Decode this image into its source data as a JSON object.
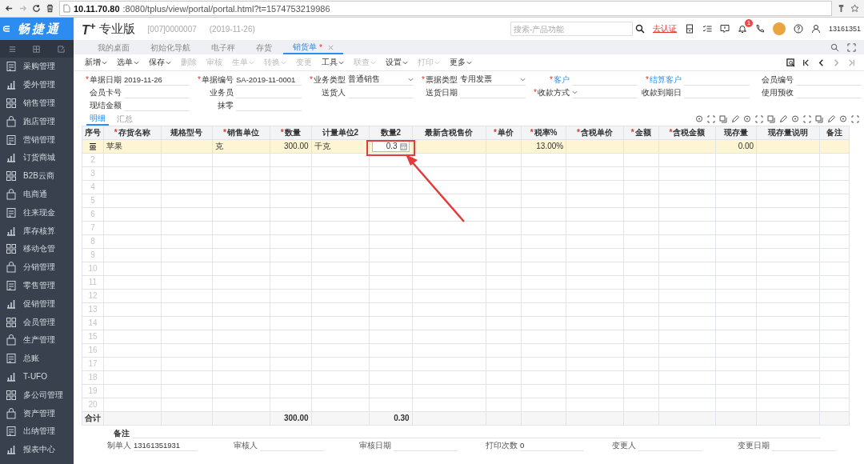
{
  "browser": {
    "url_host": "10.11.70.80",
    "url_rest": ":8080/tplus/view/portal/portal.html?t=1574753219986"
  },
  "sidebar": {
    "logo": "畅捷通",
    "items": [
      "采购管理",
      "委外管理",
      "销售管理",
      "跑店管理",
      "营销管理",
      "订货商城",
      "B2B云商",
      "电商通",
      "往来现金",
      "库存核算",
      "移动仓管",
      "分销管理",
      "零售管理",
      "促销管理",
      "会员管理",
      "生产管理",
      "总账",
      "T-UFO",
      "多公司管理",
      "资产管理",
      "出纳管理",
      "报表中心"
    ]
  },
  "header": {
    "logo": "T$^{+}$",
    "product": "专业版",
    "account": "[007]0000007",
    "date": "(2019-11-26)",
    "search": {
      "placeholder": "搜索-产品功能"
    },
    "verify_link": "去认证",
    "notification_count": "1",
    "user": "13161351"
  },
  "tabs": [
    {
      "label": "我的桌面",
      "selected": false,
      "closable": false
    },
    {
      "label": "初始化导航",
      "selected": false,
      "closable": false
    },
    {
      "label": "电子秤",
      "selected": false,
      "closable": false
    },
    {
      "label": "存货",
      "selected": false,
      "closable": false
    },
    {
      "label": "销货单",
      "selected": true,
      "closable": true,
      "modified_mark": "*"
    }
  ],
  "toolbar": [
    {
      "label": "新增",
      "dropdown": true,
      "disabled": false
    },
    {
      "label": "选单",
      "dropdown": true,
      "disabled": false
    },
    {
      "label": "保存",
      "dropdown": true,
      "disabled": false
    },
    {
      "label": "删除",
      "dropdown": false,
      "disabled": true
    },
    {
      "label": "审核",
      "dropdown": false,
      "disabled": true
    },
    {
      "label": "生单",
      "dropdown": true,
      "disabled": true
    },
    {
      "label": "转换",
      "dropdown": true,
      "disabled": true
    },
    {
      "label": "变更",
      "dropdown": false,
      "disabled": true
    },
    {
      "label": "工具",
      "dropdown": true,
      "disabled": false
    },
    {
      "label": "联查",
      "dropdown": true,
      "disabled": true
    },
    {
      "label": "设置",
      "dropdown": true,
      "disabled": false
    },
    {
      "label": "打印",
      "dropdown": true,
      "disabled": true
    },
    {
      "label": "更多",
      "dropdown": true,
      "disabled": false
    }
  ],
  "form": {
    "rows": [
      [
        {
          "label": "单据日期",
          "required_mark": "*",
          "kind": "text",
          "value": "2019-11-26"
        },
        {
          "label": "单据编号",
          "required_mark": "*",
          "kind": "text",
          "value": "SA-2019-11-0001"
        },
        {
          "label": "业务类型",
          "required_mark": "*",
          "kind": "select",
          "value": "普通销售"
        },
        {
          "label": "票据类型",
          "required_mark": "*",
          "kind": "select",
          "value": "专用发票"
        },
        {
          "label": "客户",
          "required_mark": "*",
          "kind": "lookup"
        },
        {
          "label": "结算客户",
          "required_mark": "*",
          "kind": "lookup"
        },
        {
          "label": "会员编号",
          "kind": "text"
        }
      ],
      [
        {
          "label": "会员卡号",
          "kind": "text"
        },
        {
          "label": "业务员",
          "kind": "text"
        },
        {
          "label": "送货人",
          "kind": "text"
        },
        {
          "label": "送货日期",
          "kind": "text"
        },
        {
          "label": "收款方式",
          "required_mark": "*",
          "kind": "select"
        },
        {
          "label": "收款到期日",
          "kind": "text"
        },
        {
          "label": "使用预收",
          "kind": "text"
        }
      ],
      [
        {
          "label": "现结金额",
          "kind": "text"
        },
        {
          "label": "抹零",
          "kind": "text"
        }
      ]
    ]
  },
  "detail_tabs": [
    {
      "label": "明细",
      "selected": true
    },
    {
      "label": "汇总",
      "selected": false
    }
  ],
  "table": {
    "columns": [
      {
        "label": "序号"
      },
      {
        "label": "存货名称",
        "required_mark": "*",
        "kind": "text"
      },
      {
        "label": "规格型号",
        "kind": "text"
      },
      {
        "label": "销售单位",
        "required_mark": "*",
        "kind": "text"
      },
      {
        "label": "数量",
        "required_mark": "*",
        "kind": "number",
        "total": "300.00"
      },
      {
        "label": "计量单位2",
        "kind": "text"
      },
      {
        "label": "数量2",
        "kind": "number",
        "total": "0.30"
      },
      {
        "label": "最新含税售价",
        "kind": "number"
      },
      {
        "label": "单价",
        "required_mark": "*",
        "kind": "number"
      },
      {
        "label": "税率%",
        "required_mark": "*",
        "kind": "number"
      },
      {
        "label": "含税单价",
        "required_mark": "*",
        "kind": "number"
      },
      {
        "label": "金额",
        "required_mark": "*",
        "kind": "number"
      },
      {
        "label": "含税金额",
        "required_mark": "*",
        "kind": "number"
      },
      {
        "label": "现存量",
        "kind": "number"
      },
      {
        "label": "现存量说明",
        "kind": "text"
      },
      {
        "label": "备注",
        "kind": "text"
      }
    ],
    "rows": [
      {
        "selected": true,
        "cells": [
          {
            "editing": false
          },
          {
            "text": "苹果",
            "editing": false
          },
          {
            "editing": false
          },
          {
            "text": "克",
            "editing": false
          },
          {
            "text": "300.00",
            "editing": false
          },
          {
            "text": "千克",
            "editing": false
          },
          {
            "text": "0.3",
            "editing": true
          },
          {
            "editing": false
          },
          {
            "editing": false
          },
          {
            "text": "13.00%",
            "editing": false
          },
          {
            "editing": false
          },
          {
            "editing": false
          },
          {
            "editing": false
          },
          {
            "text": "0.00",
            "editing": false
          },
          {
            "editing": false
          },
          {
            "editing": false
          }
        ]
      },
      {
        "selected": false,
        "no": "2"
      },
      {
        "selected": false,
        "no": "3"
      },
      {
        "selected": false,
        "no": "4"
      },
      {
        "selected": false,
        "no": "5"
      },
      {
        "selected": false,
        "no": "6"
      },
      {
        "selected": false,
        "no": "7"
      },
      {
        "selected": false,
        "no": "8"
      },
      {
        "selected": false,
        "no": "9"
      },
      {
        "selected": false,
        "no": "10"
      },
      {
        "selected": false,
        "no": "11"
      },
      {
        "selected": false,
        "no": "12"
      },
      {
        "selected": false,
        "no": "13"
      },
      {
        "selected": false,
        "no": "14"
      },
      {
        "selected": false,
        "no": "15"
      },
      {
        "selected": false,
        "no": "16"
      },
      {
        "selected": false,
        "no": "17"
      },
      {
        "selected": false,
        "no": "18"
      },
      {
        "selected": false,
        "no": "19"
      },
      {
        "selected": false,
        "no": "20"
      }
    ],
    "total_label": "合计"
  },
  "annotation": {
    "highlight_box": true,
    "arrow": true
  },
  "footer": {
    "remark_label": "备注",
    "fields": [
      {
        "label": "制单人",
        "value": "13161351931"
      },
      {
        "label": "审核人"
      },
      {
        "label": "审核日期"
      },
      {
        "label": "打印次数",
        "value": "0"
      },
      {
        "label": "变更人"
      },
      {
        "label": "变更日期"
      }
    ]
  }
}
